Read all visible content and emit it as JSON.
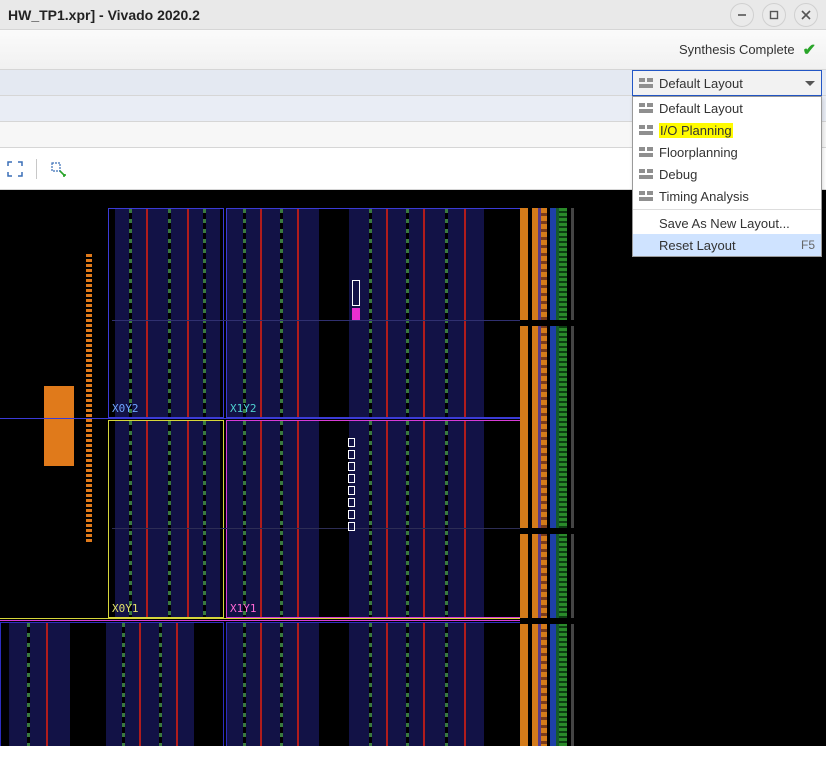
{
  "window": {
    "title": "HW_TP1.xpr] - Vivado 2020.2"
  },
  "status": {
    "text": "Synthesis Complete"
  },
  "layout_combo": {
    "selected": "Default Layout"
  },
  "layout_menu": {
    "items": [
      {
        "label": "Default Layout",
        "icon": true
      },
      {
        "label": "I/O Planning",
        "icon": true,
        "highlight": true
      },
      {
        "label": "Floorplanning",
        "icon": true
      },
      {
        "label": "Debug",
        "icon": true
      },
      {
        "label": "Timing Analysis",
        "icon": true
      }
    ],
    "save_label": "Save As New Layout...",
    "reset_label": "Reset Layout",
    "reset_shortcut": "F5"
  },
  "device": {
    "regions": {
      "x0y2": "X0Y2",
      "x1y2": "X1Y2",
      "x0y1": "X0Y1",
      "x1y1": "X1Y1"
    }
  }
}
